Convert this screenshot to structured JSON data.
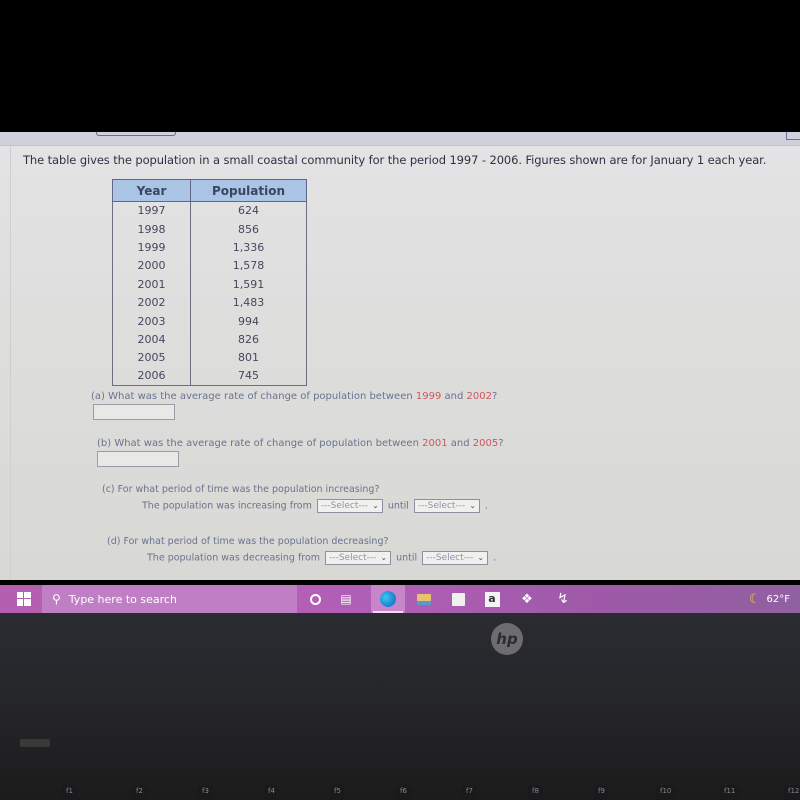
{
  "page": {
    "intro": "The table gives the population in a small coastal community for the period 1997 - 2006. Figures shown are for January 1 each year."
  },
  "table": {
    "headers": [
      "Year",
      "Population"
    ],
    "rows": [
      [
        "1997",
        "624"
      ],
      [
        "1998",
        "856"
      ],
      [
        "1999",
        "1,336"
      ],
      [
        "2000",
        "1,578"
      ],
      [
        "2001",
        "1,591"
      ],
      [
        "2002",
        "1,483"
      ],
      [
        "2003",
        "994"
      ],
      [
        "2004",
        "826"
      ],
      [
        "2005",
        "801"
      ],
      [
        "2006",
        "745"
      ]
    ]
  },
  "questions": {
    "a": {
      "prefix": "(a) What was the average rate of change of population between ",
      "y1": "1999",
      "mid": " and ",
      "y2": "2002",
      "suffix": "?",
      "answer_value": ""
    },
    "b": {
      "prefix": "(b) What was the average rate of change of population between ",
      "y1": "2001",
      "mid": " and ",
      "y2": "2005",
      "suffix": "?",
      "answer_value": ""
    },
    "c": {
      "question": "(c) For what period of time was the population increasing?",
      "lead": "The population was increasing from",
      "until": "until",
      "select_from": "---Select---",
      "select_until": "---Select---",
      "end": "."
    },
    "d": {
      "question": "(d) For what period of time was the population decreasing?",
      "lead": "The population was decreasing from",
      "until": "until",
      "select_from": "---Select---",
      "select_until": "---Select---",
      "end": "."
    }
  },
  "taskbar": {
    "search_placeholder": "Type here to search",
    "icons": [
      "windows-start",
      "search",
      "cortana-circle",
      "task-view",
      "edge",
      "file-explorer",
      "microsoft-store",
      "amazon",
      "dropbox",
      "app-bolt"
    ],
    "weather": "62°F",
    "amazon_glyph": "a"
  },
  "device": {
    "logo": "hp",
    "fkeys": [
      "f1",
      "f2",
      "f3",
      "f4",
      "f5",
      "f6",
      "f7",
      "f8",
      "f9",
      "f10",
      "f11",
      "f12"
    ]
  }
}
